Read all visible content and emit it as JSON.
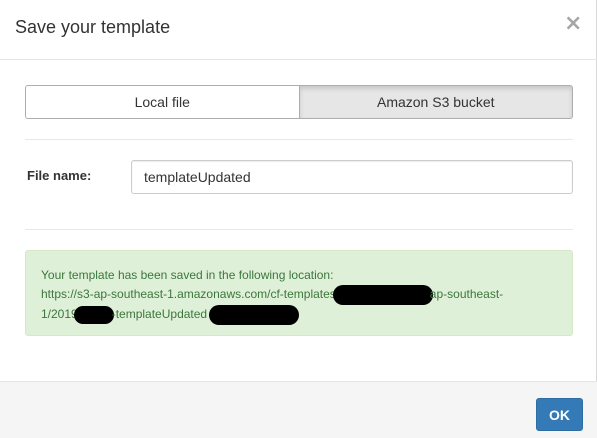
{
  "dialog": {
    "title": "Save your template",
    "close_icon": "close-icon"
  },
  "storage_toggle": {
    "options": [
      {
        "label": "Local file",
        "active": false
      },
      {
        "label": "Amazon S3 bucket",
        "active": true
      }
    ]
  },
  "form": {
    "file_name_label": "File name:",
    "file_name_value": "templateUpdated"
  },
  "alert": {
    "message": "Your template has been saved in the following location:",
    "url_part1": "https://s3-ap-southeast-1.amazonaws.com/cf-templates",
    "url_part2": "ap-southeast-",
    "url_part3": "1/2019",
    "url_part4": "-templateUpdated",
    "color": "#3c763d",
    "background": "#dff0d8"
  },
  "footer": {
    "ok_label": "OK",
    "ok_color": "#337ab7"
  }
}
